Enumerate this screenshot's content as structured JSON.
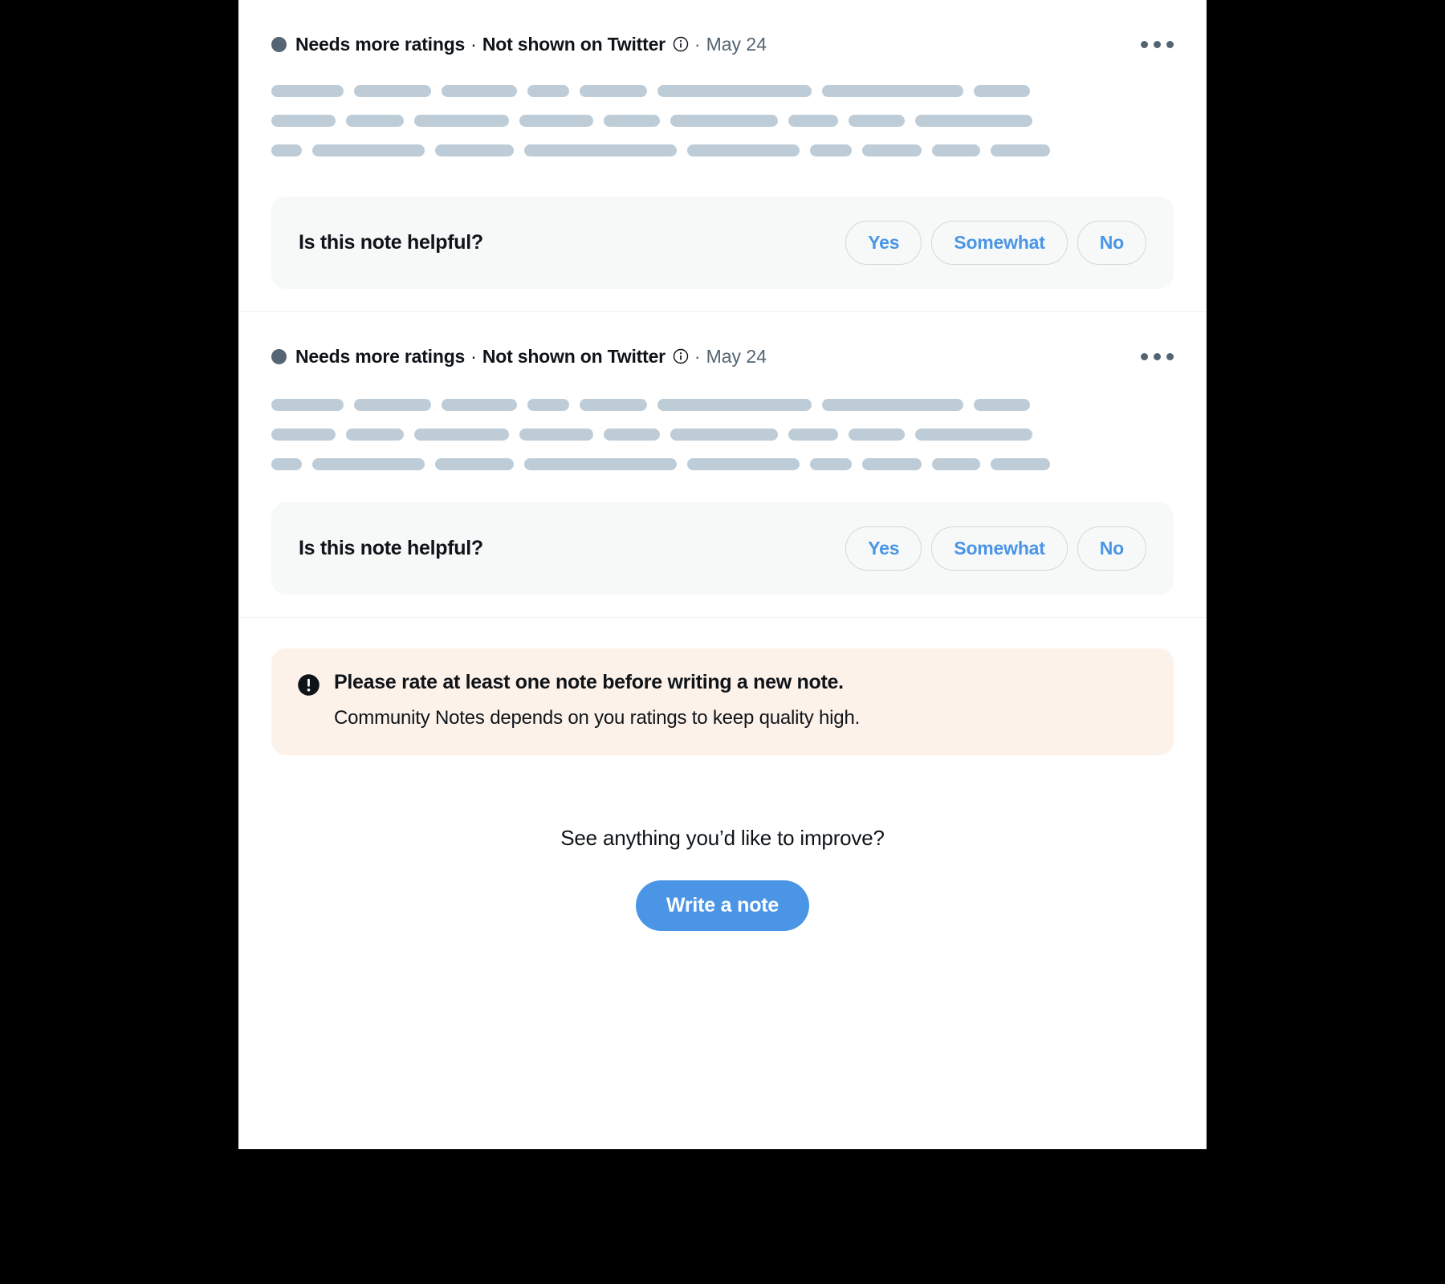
{
  "theme": {
    "card_bg": "#ffffff",
    "page_bg": "#000000",
    "accent_blue": "#4b95e6",
    "muted_text": "#536471",
    "primary_text": "#0f1419",
    "divider": "#eff3f4",
    "skeleton_bar": "#bdccd6",
    "helpful_box_bg": "#f7f9f9",
    "warning_bg": "#fdf2ea",
    "button_border": "#cfd9de"
  },
  "notes": [
    {
      "status_label": "Needs more ratings",
      "separator": "·",
      "visibility_label": "Not shown on Twitter",
      "info_icon": "info-circle-icon",
      "date": "May 24",
      "more_icon": "more-horizontal-icon",
      "skeleton_rows": [
        [
          90,
          96,
          94,
          52,
          84,
          192,
          176,
          70
        ],
        [
          80,
          72,
          118,
          92,
          70,
          134,
          62,
          70,
          146
        ],
        [
          38,
          140,
          98,
          190,
          140,
          52,
          74,
          60,
          74
        ]
      ],
      "helpful": {
        "question": "Is this note helpful?",
        "options": [
          "Yes",
          "Somewhat",
          "No"
        ]
      }
    },
    {
      "status_label": "Needs more ratings",
      "separator": "·",
      "visibility_label": "Not shown on Twitter",
      "info_icon": "info-circle-icon",
      "date": "May 24",
      "more_icon": "more-horizontal-icon",
      "skeleton_rows": [
        [
          90,
          96,
          94,
          52,
          84,
          192,
          176,
          70
        ],
        [
          80,
          72,
          118,
          92,
          70,
          134,
          62,
          70,
          146
        ],
        [
          38,
          140,
          98,
          190,
          140,
          52,
          74,
          60,
          74
        ]
      ],
      "helpful": {
        "question": "Is this note helpful?",
        "options": [
          "Yes",
          "Somewhat",
          "No"
        ]
      }
    }
  ],
  "warning": {
    "icon": "exclamation-circle-icon",
    "title": "Please rate at least one note before writing a new note.",
    "subtitle": "Community Notes depends on you ratings to keep quality high."
  },
  "cta": {
    "prompt": "See anything you’d like to improve?",
    "button_label": "Write a note"
  }
}
